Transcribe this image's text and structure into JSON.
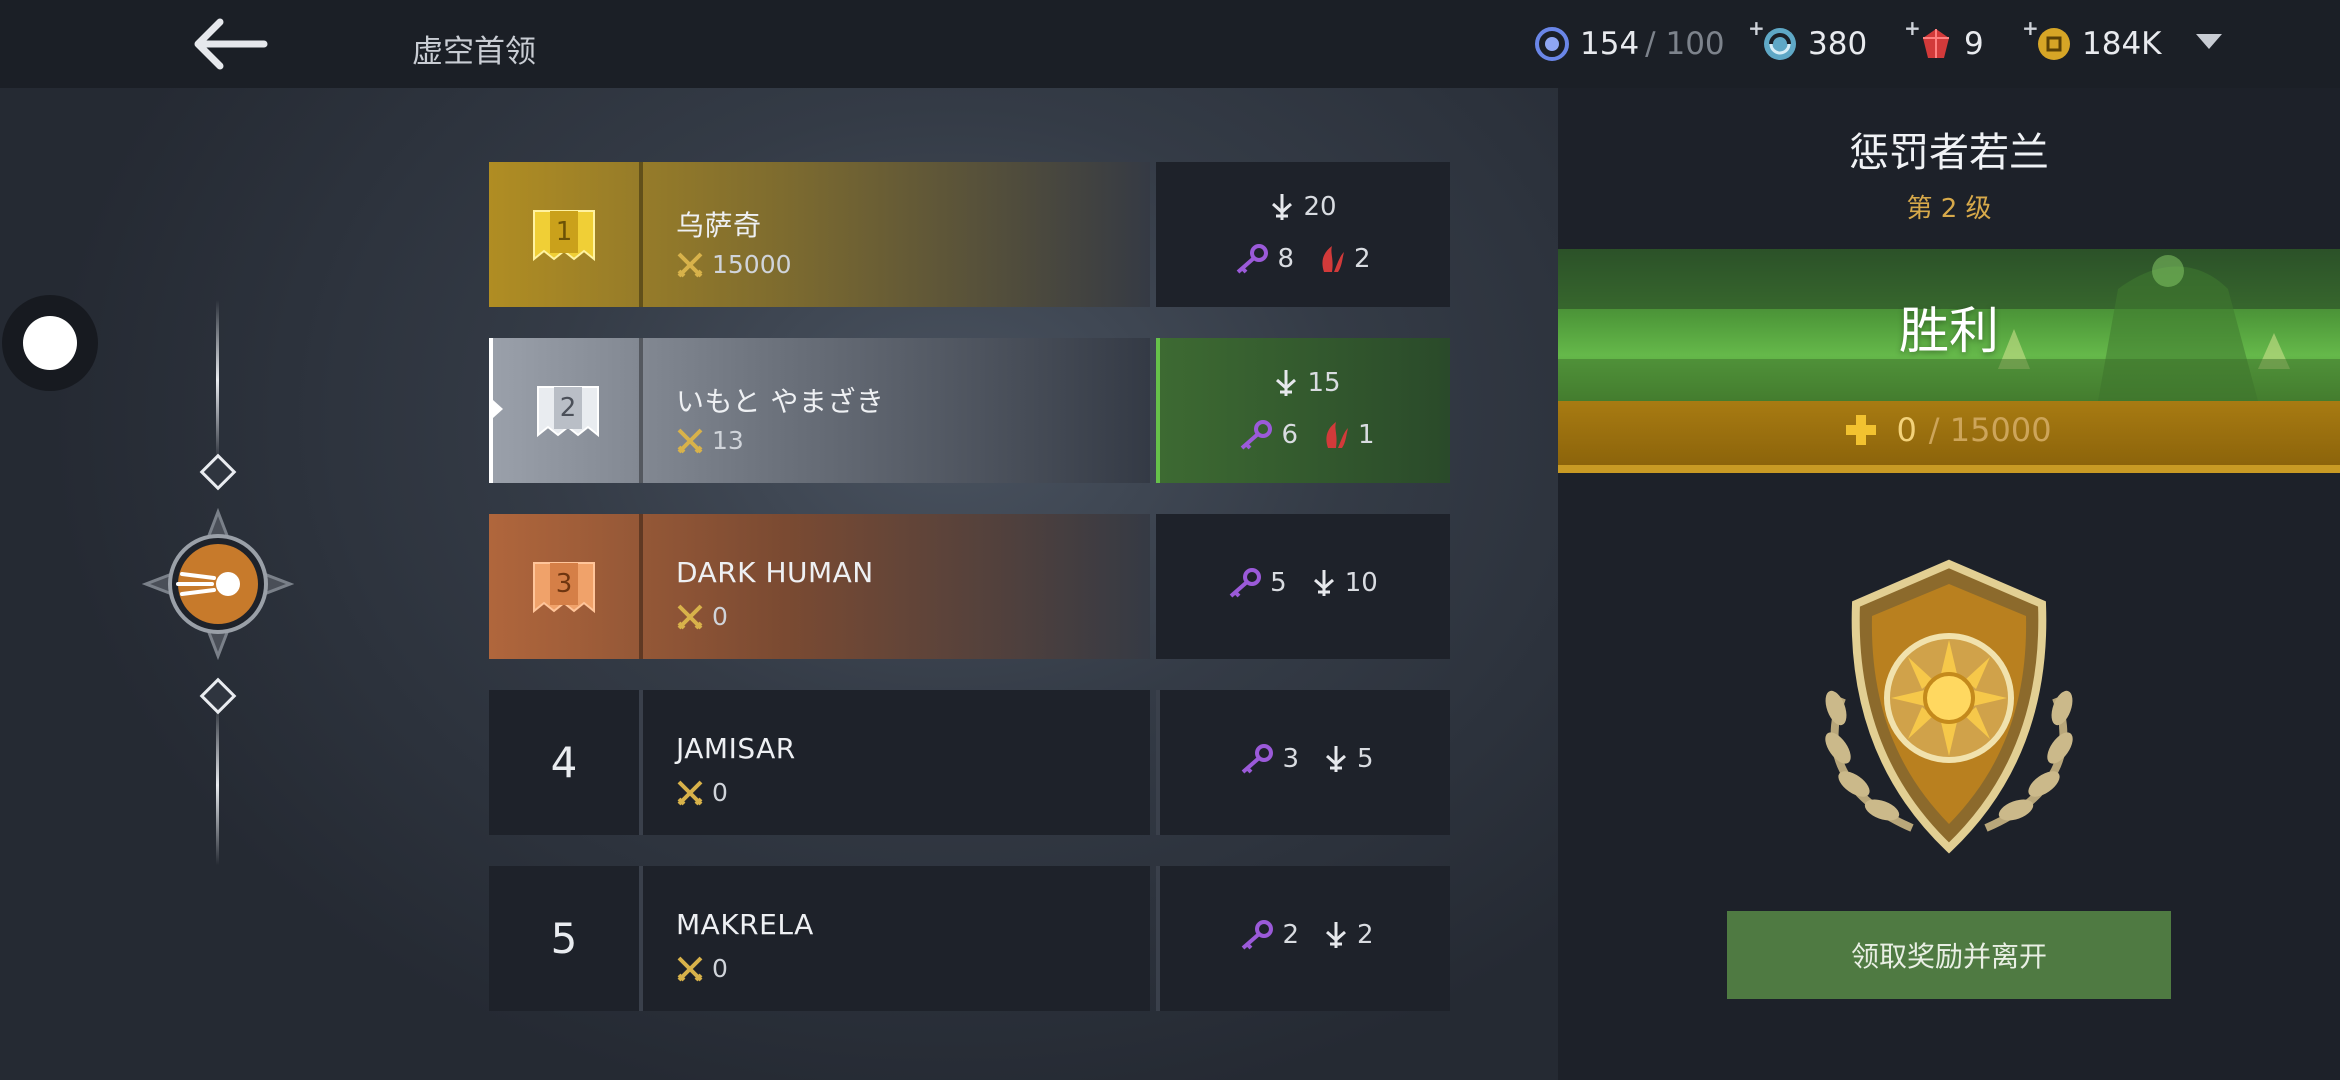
{
  "header": {
    "title": "虚空首领",
    "resources": [
      {
        "icon": "void-energy-icon",
        "value": "154",
        "max": "/ 100"
      },
      {
        "icon": "orb-swirl-icon",
        "value": "380"
      },
      {
        "icon": "red-gem-icon",
        "value": "9"
      },
      {
        "icon": "gold-coin-icon",
        "value": "184K"
      }
    ]
  },
  "leaderboard": [
    {
      "rank": "1",
      "name": "乌萨奇",
      "score": "15000",
      "stats": {
        "kills": "20",
        "keys": "8",
        "claws": "2"
      }
    },
    {
      "rank": "2",
      "name": "いもと やまざき",
      "score": "13",
      "stats": {
        "kills": "15",
        "keys": "6",
        "claws": "1"
      }
    },
    {
      "rank": "3",
      "name": "DARK HUMAN",
      "score": "0",
      "stats": {
        "keys": "5",
        "kills": "10"
      }
    },
    {
      "rank": "4",
      "name": "JAMISAR",
      "score": "0",
      "stats": {
        "keys": "3",
        "kills": "5"
      }
    },
    {
      "rank": "5",
      "name": "MAKRELA",
      "score": "0",
      "stats": {
        "keys": "2",
        "kills": "2"
      }
    }
  ],
  "boss": {
    "name": "惩罚者若兰",
    "level": "第 2 级",
    "result": "胜利",
    "progress_value": "0",
    "progress_max": "/ 15000",
    "claim_label": "领取奖励并离开"
  },
  "colors": {
    "gold": "#b08d23",
    "silver": "#8c929c",
    "bronze": "#b0663c",
    "victory_green": "#4f9a3a",
    "claim_button": "#4f7a42",
    "key_purple": "#9b5ad9",
    "claw_red": "#d23a3a"
  }
}
